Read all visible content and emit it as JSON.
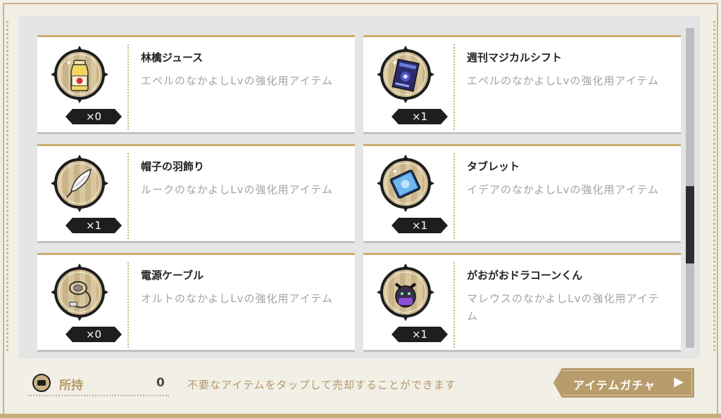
{
  "items": [
    {
      "name": "林檎ジュース",
      "desc": "エペルのなかよしLvの強化用アイテム",
      "qty": "×0",
      "icon": "apple-juice-icon"
    },
    {
      "name": "週刊マジカルシフト",
      "desc": "エペルのなかよしLvの強化用アイテム",
      "qty": "×1",
      "icon": "magazine-icon"
    },
    {
      "name": "帽子の羽飾り",
      "desc": "ルークのなかよしLvの強化用アイテム",
      "qty": "×1",
      "icon": "feather-icon"
    },
    {
      "name": "タブレット",
      "desc": "イデアのなかよしLvの強化用アイテム",
      "qty": "×1",
      "icon": "tablet-icon"
    },
    {
      "name": "電源ケーブル",
      "desc": "オルトのなかよしLvの強化用アイテム",
      "qty": "×0",
      "icon": "power-cable-icon"
    },
    {
      "name": "がおがおドラコーンくん",
      "desc": "マレウスのなかよしLvの強化用アイテム",
      "qty": "×1",
      "icon": "dragon-plush-icon"
    }
  ],
  "footer": {
    "held_label": "所持",
    "held_value": "0",
    "hint": "不要なアイテムをタップして売却することができます",
    "gacha_button": "アイテムガチャ",
    "gacha_arrow": "▶"
  },
  "colors": {
    "accent_gold": "#c9ae6f",
    "button": "#b89c6b",
    "badge": "#1e1e1e"
  }
}
